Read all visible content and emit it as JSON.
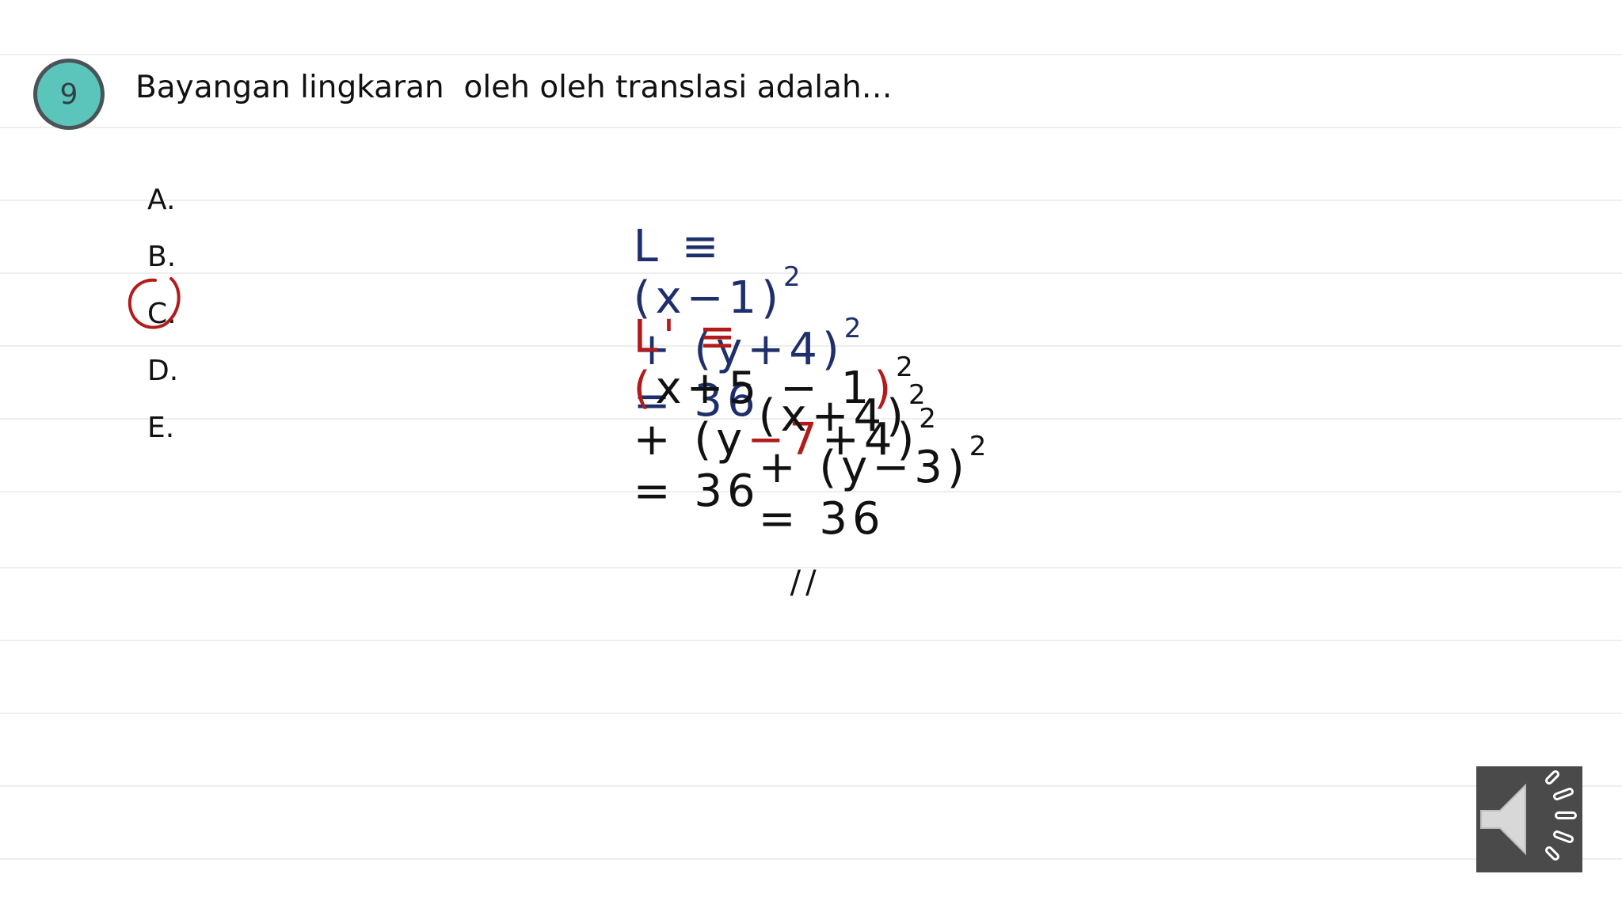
{
  "question": {
    "number": "9",
    "text": "Bayangan lingkaran  oleh oleh translasi adalah…"
  },
  "options": [
    "A.",
    "B.",
    "C.",
    "D.",
    "E."
  ],
  "selected_option": "C.",
  "working": {
    "line1": {
      "lhs": "L ≡",
      "expr": "(x−1)",
      "exp1": "2",
      "mid": "+ (y+4)",
      "exp2": "2",
      "rhs": "= 36"
    },
    "line2": {
      "lhs": "L' ≡",
      "p1": "(",
      "p2": "x+5 − 1",
      "p3": ")",
      "exp1": "2",
      "p4": "+ (y",
      "p5": "−7",
      "p6": "+4)",
      "exp2": "2",
      "rhs": "= 36"
    },
    "line3": {
      "expr1": "(x+4)",
      "exp1": "2",
      "mid": "+ (y−3)",
      "exp2": "2",
      "rhs": "= 36",
      "mark": "//"
    }
  },
  "colors": {
    "badge": "#5bc5bc",
    "ink_blue": "#1f2f6b",
    "ink_red": "#b31b1b"
  },
  "icons": {
    "audio": "speaker-icon"
  }
}
